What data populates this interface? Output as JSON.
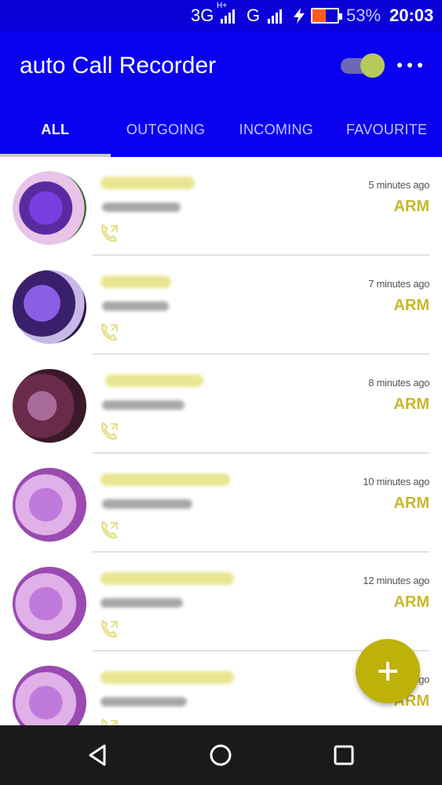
{
  "status_bar": {
    "network_type": "3G",
    "network_sub": "H+",
    "network_type_2": "G",
    "battery_percent": "53%",
    "battery_level": 0.53,
    "time": "20:03",
    "icons": [
      "signal-icon",
      "signal-icon",
      "charging-icon",
      "battery-icon"
    ]
  },
  "app_bar": {
    "title": "auto Call Recorder",
    "toggle_on": true,
    "overflow_icon": "more-vertical-icon",
    "background": "#0a00f0"
  },
  "tabs": [
    {
      "label": "ALL",
      "active": true
    },
    {
      "label": "OUTGOING",
      "active": false
    },
    {
      "label": "INCOMING",
      "active": false
    },
    {
      "label": "FAVOURITE",
      "active": false
    }
  ],
  "calls": [
    {
      "time": "5 minutes ago",
      "sim": "ARM",
      "icon": "outgoing-call-icon"
    },
    {
      "time": "7 minutes ago",
      "sim": "ARM",
      "icon": "outgoing-call-icon"
    },
    {
      "time": "8 minutes ago",
      "sim": "ARM",
      "icon": "outgoing-call-icon"
    },
    {
      "time": "10 minutes ago",
      "sim": "ARM",
      "icon": "outgoing-call-icon"
    },
    {
      "time": "12 minutes ago",
      "sim": "ARM",
      "icon": "outgoing-call-icon"
    },
    {
      "time": "12 minutes ago",
      "sim": "ARM",
      "icon": "outgoing-call-icon"
    }
  ],
  "fab": {
    "icon": "add-icon",
    "color": "#bdb10a"
  },
  "nav_bar": {
    "icons": [
      "back-icon",
      "home-icon",
      "recents-icon"
    ]
  },
  "colors": {
    "accent": "#c8b82a",
    "primary": "#0a00f0"
  }
}
